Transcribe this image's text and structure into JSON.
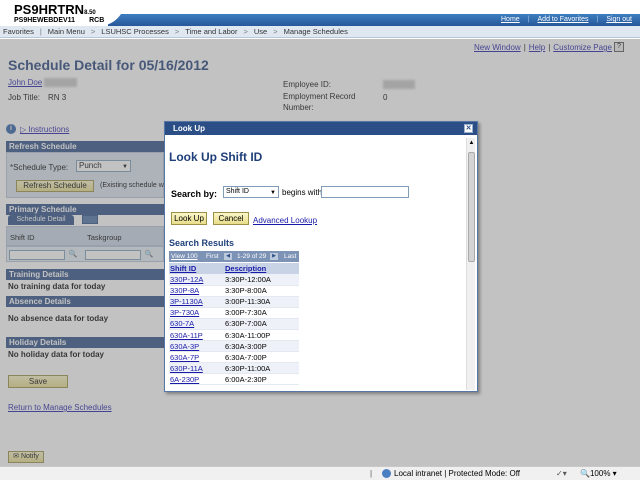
{
  "header": {
    "app_name": "PS9HRTRN",
    "app_version": "8.50",
    "server": "PS9HEWEBDEV11",
    "server_suffix": "RCB",
    "links": [
      "Home",
      "Add to Favorites",
      "Sign out"
    ]
  },
  "nav": {
    "items": [
      "Favorites",
      "Main Menu",
      "LSUHSC Processes",
      "Time and Labor",
      "Use",
      "Manage Schedules"
    ]
  },
  "page_links": {
    "new_window": "New Window",
    "help": "Help",
    "customize": "Customize Page"
  },
  "page": {
    "title": "Schedule Detail for 05/16/2012",
    "employee_name": "John Doe",
    "job_title_label": "Job Title:",
    "job_title_value": "RN 3",
    "employee_id_label": "Employee ID:",
    "employee_record_label": "Employment Record Number:",
    "employee_record_value": "0",
    "instructions": "Instructions"
  },
  "refresh_schedule": {
    "header": "Refresh Schedule",
    "schedule_type_label": "*Schedule Type:",
    "schedule_type_value": "Punch",
    "refresh_button": "Refresh Schedule",
    "note": "(Existing schedule w"
  },
  "primary_schedule": {
    "header": "Primary Schedule",
    "tab": "Schedule Detail",
    "columns": [
      "Shift ID",
      "Taskgroup"
    ]
  },
  "training": {
    "header": "Training Details",
    "empty": "No training data for today"
  },
  "absence": {
    "header": "Absence Details",
    "empty": "No absence data for today"
  },
  "holiday": {
    "header": "Holiday Details",
    "empty": "No holiday data for today"
  },
  "actions": {
    "save": "Save",
    "return_link": "Return to Manage Schedules",
    "notify": "Notify"
  },
  "modal": {
    "title": "Look Up",
    "heading": "Look Up Shift ID",
    "search_by_label": "Search by:",
    "search_by_value": "Shift ID",
    "begins_with": "begins with",
    "search_value": "",
    "lookup_button": "Look Up",
    "cancel_button": "Cancel",
    "advanced_lookup": "Advanced Lookup",
    "results_heading": "Search Results",
    "results_nav": {
      "view": "View 100",
      "first": "First",
      "count": "1-29 of 29",
      "last": "Last"
    },
    "columns": [
      "Shift ID",
      "Description"
    ],
    "rows": [
      [
        "330P-12A",
        "3:30P-12:00A"
      ],
      [
        "330P-8A",
        "3:30P-8:00A"
      ],
      [
        "3P-1130A",
        "3:00P-11:30A"
      ],
      [
        "3P-730A",
        "3:00P-7:30A"
      ],
      [
        "630-7A",
        "6:30P-7:00A"
      ],
      [
        "630A-11P",
        "6:30A-11:00P"
      ],
      [
        "630A-3P",
        "6:30A-3:00P"
      ],
      [
        "630A-7P",
        "6:30A-7:00P"
      ],
      [
        "630P-11A",
        "6:30P-11:00A"
      ],
      [
        "6A-230P",
        "6:00A-2:30P"
      ]
    ]
  },
  "statusbar": {
    "zone": "Local intranet | Protected Mode: Off",
    "zoom": "100%"
  }
}
